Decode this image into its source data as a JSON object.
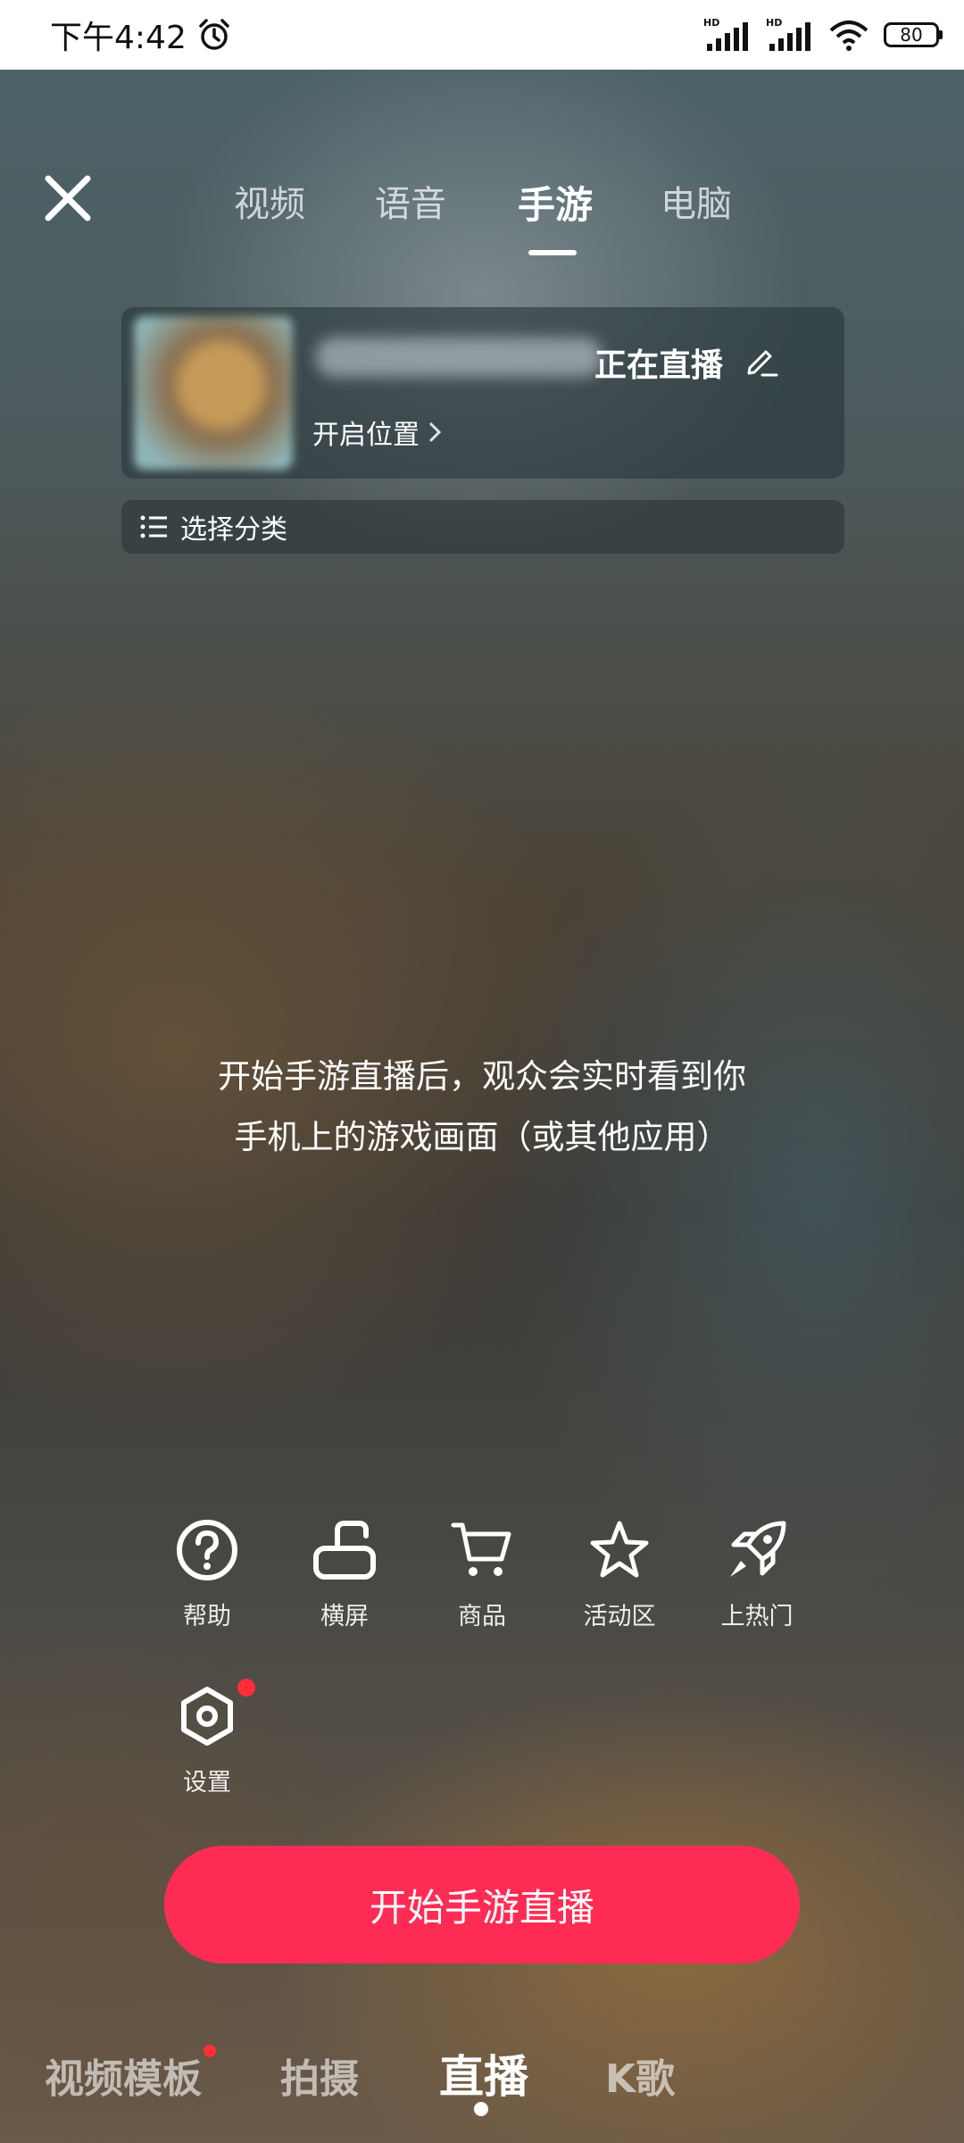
{
  "status_bar": {
    "time": "下午4:42",
    "battery": "80"
  },
  "top_tabs": [
    "视频",
    "语音",
    "手游",
    "电脑"
  ],
  "top_tabs_active": "手游",
  "live_card": {
    "title": "正在直播",
    "location": "开启位置"
  },
  "category": {
    "label": "选择分类"
  },
  "description": {
    "line1": "开始手游直播后，观众会实时看到你",
    "line2": "手机上的游戏画面（或其他应用）"
  },
  "tools": [
    {
      "label": "帮助",
      "icon": "help-circle-icon"
    },
    {
      "label": "横屏",
      "icon": "landscape-icon"
    },
    {
      "label": "商品",
      "icon": "cart-icon"
    },
    {
      "label": "活动区",
      "icon": "star-icon"
    },
    {
      "label": "上热门",
      "icon": "rocket-icon"
    },
    {
      "label": "设置",
      "icon": "settings-hex-icon",
      "badge": true
    }
  ],
  "start_button": "开始手游直播",
  "bottom_tabs": [
    "视频模板",
    "拍摄",
    "直播",
    "K歌"
  ],
  "bottom_tabs_active": "直播",
  "colors": {
    "accent": "#fe2c55",
    "badge": "#ff2d3a"
  }
}
